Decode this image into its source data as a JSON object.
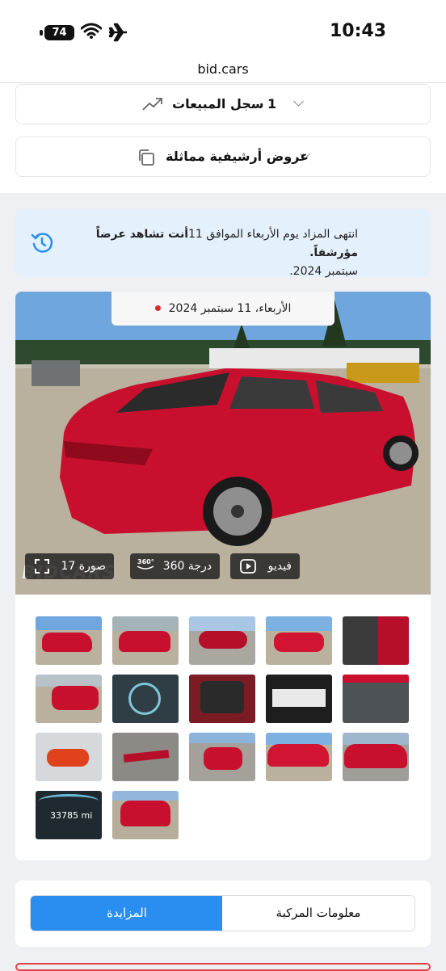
{
  "status_bar": {
    "time": "10:43",
    "battery": "74"
  },
  "browser": {
    "url": "bid.cars"
  },
  "sections": {
    "sales_history": {
      "label": "سجل المبيعات",
      "count": "1"
    },
    "archived_offers": {
      "label": "عروض أرشيفية مماثلة"
    }
  },
  "notice": {
    "line1_prefix": "انتهى المزاد يوم الأربعاء الموافق 11",
    "line1_bold": "أنت تشاهد عرضاً مؤرشفاً.",
    "line2": "سبتمبر 2024."
  },
  "gallery": {
    "date": "الأربعاء، 11 سبتمبر 2024",
    "photo_count_label": "17 صورة",
    "spin_label": "360 درجة",
    "video_label": "فيديو",
    "watermark": "BIDCARS",
    "odometer": "33785 mi"
  },
  "tabs": {
    "auction": "المزايدة",
    "vehicle_info": "معلومات المركبة"
  },
  "colors": {
    "accent": "#2a8ef0",
    "car_red": "#c8102e",
    "notice_bg": "#e4f0fb"
  }
}
